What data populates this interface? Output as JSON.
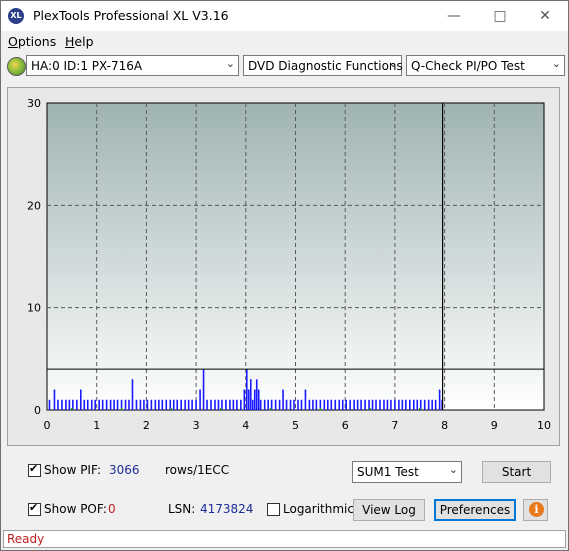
{
  "window": {
    "title": "PlexTools Professional XL V3.16",
    "icon_text": "XL"
  },
  "menu": [
    {
      "label": "Options",
      "mnemonic": "O",
      "rest": "ptions"
    },
    {
      "label": "Help",
      "mnemonic": "H",
      "rest": "elp"
    }
  ],
  "toolbar": {
    "drive": "HA:0 ID:1  PX-716A",
    "function": "DVD Diagnostic Functions",
    "test": "Q-Check PI/PO Test"
  },
  "chart_data": {
    "type": "bar",
    "title": "",
    "xlabel": "",
    "ylabel": "",
    "xlim": [
      0,
      10
    ],
    "ylim": [
      0,
      30
    ],
    "x_ticks": [
      0,
      1,
      2,
      3,
      4,
      5,
      6,
      7,
      8,
      9,
      10
    ],
    "y_ticks": [
      0,
      10,
      20,
      30
    ],
    "grid": true,
    "threshold_line": 4,
    "progress_marker_x": 7.96,
    "series": [
      {
        "color": "#1a1aff",
        "x": [
          0.05,
          0.15,
          0.22,
          0.3,
          0.38,
          0.45,
          0.52,
          0.6,
          0.68,
          0.75,
          0.82,
          0.9,
          0.97,
          1.05,
          1.12,
          1.2,
          1.28,
          1.35,
          1.42,
          1.5,
          1.58,
          1.65,
          1.72,
          1.8,
          1.88,
          1.95,
          2.02,
          2.1,
          2.18,
          2.25,
          2.32,
          2.4,
          2.48,
          2.55,
          2.62,
          2.7,
          2.78,
          2.85,
          2.92,
          3.0,
          3.08,
          3.15,
          3.22,
          3.3,
          3.38,
          3.45,
          3.52,
          3.6,
          3.68,
          3.75,
          3.82,
          3.9,
          3.97,
          4.02,
          4.06,
          4.1,
          4.14,
          4.18,
          4.22,
          4.26,
          4.3,
          4.38,
          4.45,
          4.52,
          4.6,
          4.68,
          4.75,
          4.82,
          4.9,
          4.97,
          5.05,
          5.12,
          5.2,
          5.28,
          5.35,
          5.42,
          5.5,
          5.58,
          5.65,
          5.72,
          5.8,
          5.88,
          5.95,
          6.02,
          6.1,
          6.18,
          6.25,
          6.32,
          6.4,
          6.48,
          6.55,
          6.62,
          6.7,
          6.78,
          6.85,
          6.92,
          7.0,
          7.08,
          7.15,
          7.22,
          7.3,
          7.38,
          7.45,
          7.52,
          7.6,
          7.68,
          7.75,
          7.82,
          7.9,
          7.95
        ],
        "values": [
          1,
          2,
          1,
          1,
          1,
          1,
          1,
          1,
          2,
          1,
          1,
          1,
          1,
          1,
          1,
          1,
          1,
          1,
          1,
          1,
          1,
          1,
          3,
          1,
          1,
          1,
          1,
          1,
          1,
          1,
          1,
          1,
          1,
          1,
          1,
          1,
          1,
          1,
          1,
          1,
          2,
          4,
          1,
          1,
          1,
          1,
          1,
          1,
          1,
          1,
          1,
          1,
          2,
          4,
          2,
          3,
          1,
          2,
          3,
          2,
          1,
          1,
          1,
          1,
          1,
          1,
          2,
          1,
          1,
          1,
          1,
          1,
          2,
          1,
          1,
          1,
          1,
          1,
          1,
          1,
          1,
          1,
          1,
          1,
          1,
          1,
          1,
          1,
          1,
          1,
          1,
          1,
          1,
          1,
          1,
          1,
          1,
          1,
          1,
          1,
          1,
          1,
          1,
          1,
          1,
          1,
          1,
          1,
          2,
          1
        ]
      },
      {
        "color": "#20a020",
        "x": [
          0.5,
          1.5,
          2.5,
          3.5,
          4.5,
          5.5,
          6.5,
          7.5
        ],
        "values": [
          0.2,
          0.2,
          0.2,
          0.2,
          0.2,
          0.2,
          0.2,
          0.2
        ]
      }
    ]
  },
  "bottom": {
    "show_pif_label": "Show PIF:",
    "pif_value": "3066",
    "pif_unit": "rows/1ECC",
    "show_pof_label": "Show POF:",
    "pof_value": "0",
    "lsn_label": "LSN:",
    "lsn_value": "4173824",
    "log_label": "Logarithmic",
    "test_select": "SUM1 Test",
    "start_label": "Start",
    "view_log_label": "View Log",
    "preferences_label": "Preferences",
    "info_glyph": "i"
  },
  "status": {
    "text": "Ready"
  }
}
